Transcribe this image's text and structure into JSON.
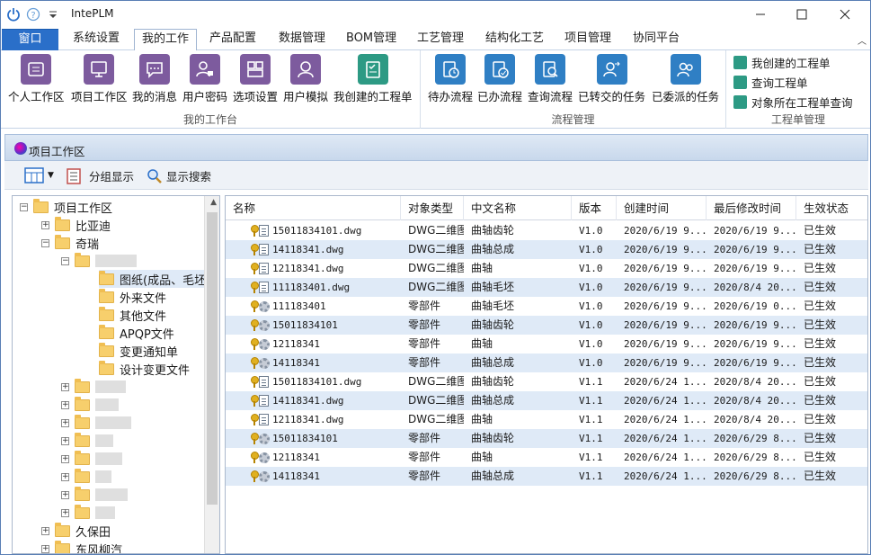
{
  "app": {
    "title": "IntePLM"
  },
  "tabs": [
    "窗口",
    "系统设置",
    "我的工作",
    "产品配置",
    "数据管理",
    "BOM管理",
    "工艺管理",
    "结构化工艺",
    "项目管理",
    "协同平台"
  ],
  "ribbon": {
    "groups": {
      "workbench": "我的工作台",
      "flow": "流程管理",
      "workorder": "工程单管理"
    },
    "workbench_buttons": [
      "个人工作区",
      "项目工作区",
      "我的消息",
      "用户密码",
      "选项设置",
      "用户模拟",
      "我创建的工程单"
    ],
    "flow_buttons": [
      "待办流程",
      "已办流程",
      "查询流程",
      "已转交的任务",
      "已委派的任务"
    ],
    "workorder_items": [
      "我创建的工程单",
      "查询工程单",
      "对象所在工程单查询"
    ]
  },
  "panel": {
    "title": "项目工作区"
  },
  "toolbar": {
    "group_label": "分组显示",
    "search_label": "显示搜索"
  },
  "tree": {
    "root": "项目工作区",
    "items": [
      "比亚迪",
      "奇瑞"
    ],
    "sub_items": [
      "图纸(成品、毛坯",
      "外来文件",
      "其他文件",
      "APQP文件",
      "变更通知单",
      "设计变更文件"
    ],
    "bottom_items": [
      "久保田",
      "东风柳汽"
    ]
  },
  "grid": {
    "columns": [
      "名称",
      "对象类型",
      "中文名称",
      "版本",
      "创建时间",
      "最后修改时间",
      "生效状态"
    ],
    "rows": [
      {
        "name": "15011834101.dwg",
        "type": "DWG二维图",
        "cn": "曲轴齿轮",
        "ver": "V1.0",
        "created": "2020/6/19 9...",
        "modified": "2020/6/19 9...",
        "status": "已生效",
        "kind": "doc"
      },
      {
        "name": "14118341.dwg",
        "type": "DWG二维图",
        "cn": "曲轴总成",
        "ver": "V1.0",
        "created": "2020/6/19 9...",
        "modified": "2020/6/19 9...",
        "status": "已生效",
        "kind": "doc"
      },
      {
        "name": "12118341.dwg",
        "type": "DWG二维图",
        "cn": "曲轴",
        "ver": "V1.0",
        "created": "2020/6/19 9...",
        "modified": "2020/6/19 9...",
        "status": "已生效",
        "kind": "doc"
      },
      {
        "name": "111183401.dwg",
        "type": "DWG二维图",
        "cn": "曲轴毛坯",
        "ver": "V1.0",
        "created": "2020/6/19 9...",
        "modified": "2020/8/4 20...",
        "status": "已生效",
        "kind": "doc"
      },
      {
        "name": "111183401",
        "type": "零部件",
        "cn": "曲轴毛坯",
        "ver": "V1.0",
        "created": "2020/6/19 9...",
        "modified": "2020/6/19 0...",
        "status": "已生效",
        "kind": "part"
      },
      {
        "name": "15011834101",
        "type": "零部件",
        "cn": "曲轴齿轮",
        "ver": "V1.0",
        "created": "2020/6/19 9...",
        "modified": "2020/6/19 9...",
        "status": "已生效",
        "kind": "part"
      },
      {
        "name": "12118341",
        "type": "零部件",
        "cn": "曲轴",
        "ver": "V1.0",
        "created": "2020/6/19 9...",
        "modified": "2020/6/19 9...",
        "status": "已生效",
        "kind": "part"
      },
      {
        "name": "14118341",
        "type": "零部件",
        "cn": "曲轴总成",
        "ver": "V1.0",
        "created": "2020/6/19 9...",
        "modified": "2020/6/19 9...",
        "status": "已生效",
        "kind": "part"
      },
      {
        "name": "15011834101.dwg",
        "type": "DWG二维图",
        "cn": "曲轴齿轮",
        "ver": "V1.1",
        "created": "2020/6/24 1...",
        "modified": "2020/8/4 20...",
        "status": "已生效",
        "kind": "doc"
      },
      {
        "name": "14118341.dwg",
        "type": "DWG二维图",
        "cn": "曲轴总成",
        "ver": "V1.1",
        "created": "2020/6/24 1...",
        "modified": "2020/8/4 20...",
        "status": "已生效",
        "kind": "doc"
      },
      {
        "name": "12118341.dwg",
        "type": "DWG二维图",
        "cn": "曲轴",
        "ver": "V1.1",
        "created": "2020/6/24 1...",
        "modified": "2020/8/4 20...",
        "status": "已生效",
        "kind": "doc"
      },
      {
        "name": "15011834101",
        "type": "零部件",
        "cn": "曲轴齿轮",
        "ver": "V1.1",
        "created": "2020/6/24 1...",
        "modified": "2020/6/29 8...",
        "status": "已生效",
        "kind": "part"
      },
      {
        "name": "12118341",
        "type": "零部件",
        "cn": "曲轴",
        "ver": "V1.1",
        "created": "2020/6/24 1...",
        "modified": "2020/6/29 8...",
        "status": "已生效",
        "kind": "part"
      },
      {
        "name": "14118341",
        "type": "零部件",
        "cn": "曲轴总成",
        "ver": "V1.1",
        "created": "2020/6/24 1...",
        "modified": "2020/6/29 8...",
        "status": "已生效",
        "kind": "part"
      }
    ]
  },
  "colors": {
    "accent": "#2a6fc9",
    "row_alt": "#dfeaf7",
    "icon_purple": "#7d5b9e",
    "icon_teal": "#2d9a84",
    "icon_blue": "#2f7fc4"
  }
}
